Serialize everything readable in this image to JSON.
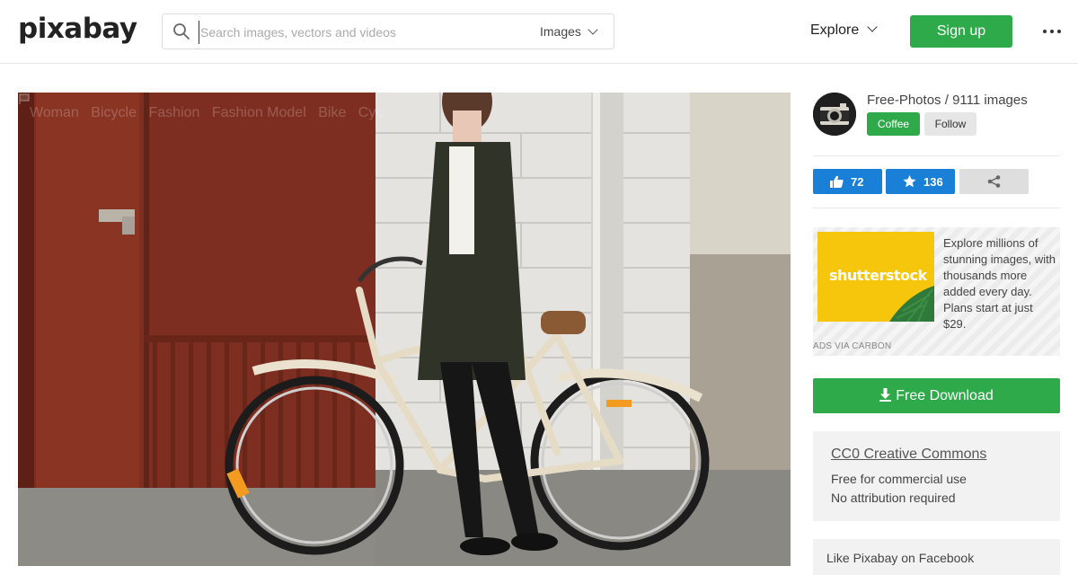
{
  "header": {
    "logo": "pixabay",
    "search": {
      "placeholder": "Search images, vectors and videos",
      "value": "",
      "type_label": "Images"
    },
    "explore_label": "Explore",
    "signup_label": "Sign up"
  },
  "photo": {
    "tags": [
      "Woman",
      "Bicycle",
      "Fashion",
      "Fashion Model",
      "Bike",
      "Cyc"
    ]
  },
  "sidebar": {
    "user": {
      "name": "Free-Photos",
      "separator": " / ",
      "count_text": "9111 images"
    },
    "coffee_label": "Coffee",
    "follow_label": "Follow",
    "likes": "72",
    "favorites": "136",
    "ad": {
      "logo_text": "shutterstock",
      "text": "Explore millions of stunning images, with thousands more added every day. Plans start at just $29.",
      "via": "ADS VIA CARBON"
    },
    "download_label": "Free Download",
    "license": {
      "title": "CC0 Creative Commons",
      "line1": "Free for commercial use",
      "line2": "No attribution required"
    },
    "facebook_label": "Like Pixabay on Facebook"
  },
  "colors": {
    "green": "#2eaa4a",
    "blue": "#1a80d7",
    "ad_yellow": "#f5c60c"
  }
}
